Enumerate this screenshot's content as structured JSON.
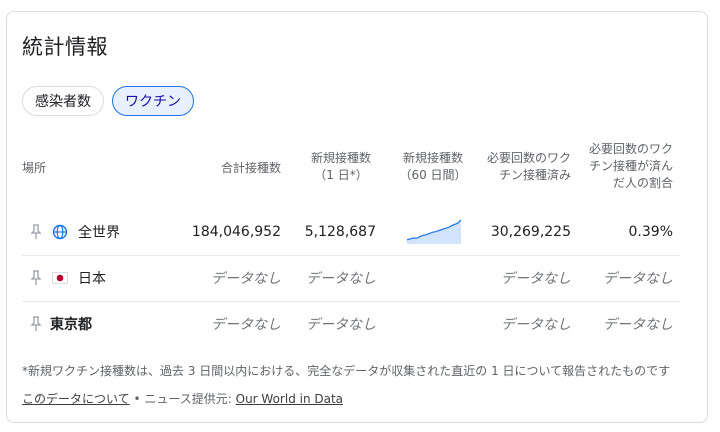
{
  "title": "統計情報",
  "chips": [
    {
      "label": "感染者数",
      "active": false
    },
    {
      "label": "ワクチン",
      "active": true
    }
  ],
  "headers": {
    "location": "場所",
    "total": "合計接種数",
    "new_daily_1": "新規接種数",
    "new_daily_2": "（1 日*）",
    "new_60_1": "新規接種数",
    "new_60_2": "（60 日間）",
    "fully_1": "必要回数のワク",
    "fully_2": "チン接種済み",
    "pct_1": "必要回数のワク",
    "pct_2": "チン接種が済ん",
    "pct_3": "だ人の割合"
  },
  "rows": [
    {
      "location": "全世界",
      "icon": "globe-icon",
      "total": "184,046,952",
      "new_daily": "5,128,687",
      "fully": "30,269,225",
      "pct": "0.39%"
    },
    {
      "location": "日本",
      "icon": "japan-flag-icon",
      "total": "データなし",
      "new_daily": "データなし",
      "fully": "データなし",
      "pct": "データなし"
    },
    {
      "location": "東京都",
      "icon": "",
      "total": "データなし",
      "new_daily": "データなし",
      "fully": "データなし",
      "pct": "データなし"
    }
  ],
  "sparkline": [
    0.1,
    0.14,
    0.18,
    0.17,
    0.24,
    0.3,
    0.33,
    0.38,
    0.44,
    0.47,
    0.52,
    0.57,
    0.62,
    0.66,
    0.74,
    0.8,
    0.86,
    1.0
  ],
  "colors": {
    "accent": "#1a73e8",
    "spark_fill": "#d2e3fc",
    "flag_red": "#bc002d"
  },
  "footnote": "*新規ワクチン接種数は、過去 3 日間以内における、完全なデータが収集された直近の 1 日について報告されたものです",
  "footer": {
    "about_link": "このデータについて",
    "separator": " • ニュース提供元: ",
    "source_link": "Our World in Data"
  }
}
